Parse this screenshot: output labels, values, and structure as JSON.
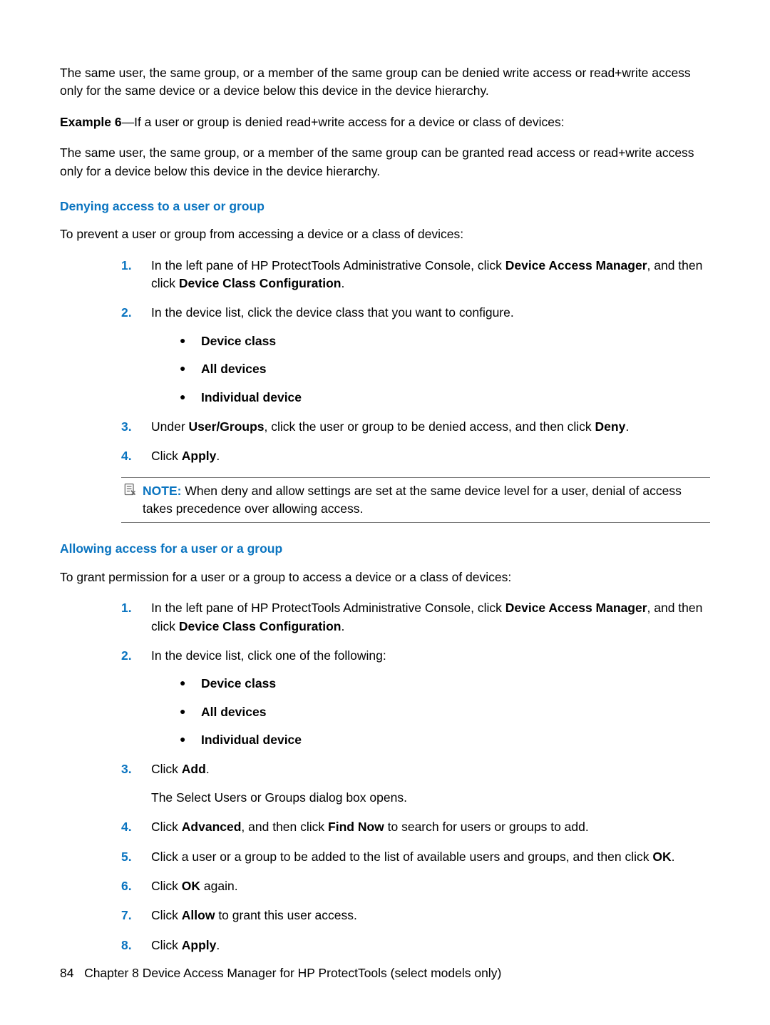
{
  "intro": {
    "p1_before": "The same user, the same group, or a member of the same group can be denied write access or read+write access only for the same device or a device below this device in the device hierarchy.",
    "example_label": "Example 6",
    "example_text": "—If a user or group is denied read+write access for a device or class of devices:",
    "p2": "The same user, the same group, or a member of the same group can be granted read access or read+write access only for a device below this device in the device hierarchy."
  },
  "deny": {
    "title": "Denying access to a user or group",
    "lead": "To prevent a user or group from accessing a device or a class of devices:",
    "steps": {
      "s1a": "In the left pane of HP ProtectTools Administrative Console, click ",
      "s1b": "Device Access Manager",
      "s1c": ", and then click ",
      "s1d": "Device Class Configuration",
      "s1e": ".",
      "s2": "In the device list, click the device class that you want to configure.",
      "bullets": {
        "b1": "Device class",
        "b2": "All devices",
        "b3": "Individual device"
      },
      "s3a": "Under ",
      "s3b": "User/Groups",
      "s3c": ", click the user or group to be denied access, and then click ",
      "s3d": "Deny",
      "s3e": ".",
      "s4a": "Click ",
      "s4b": "Apply",
      "s4c": "."
    },
    "note_label": "NOTE:",
    "note_text": "When deny and allow settings are set at the same device level for a user, denial of access takes precedence over allowing access."
  },
  "allow": {
    "title": "Allowing access for a user or a group",
    "lead": "To grant permission for a user or a group to access a device or a class of devices:",
    "steps": {
      "s1a": "In the left pane of HP ProtectTools Administrative Console, click ",
      "s1b": "Device Access Manager",
      "s1c": ", and then click ",
      "s1d": "Device Class Configuration",
      "s1e": ".",
      "s2": "In the device list, click one of the following:",
      "bullets": {
        "b1": "Device class",
        "b2": "All devices",
        "b3": "Individual device"
      },
      "s3a": "Click ",
      "s3b": "Add",
      "s3c": ".",
      "s3_after": "The Select Users or Groups dialog box opens.",
      "s4a": "Click ",
      "s4b": "Advanced",
      "s4c": ", and then click ",
      "s4d": "Find Now",
      "s4e": " to search for users or groups to add.",
      "s5a": "Click a user or a group to be added to the list of available users and groups, and then click ",
      "s5b": "OK",
      "s5c": ".",
      "s6a": "Click ",
      "s6b": "OK",
      "s6c": " again.",
      "s7a": "Click ",
      "s7b": "Allow",
      "s7c": " to grant this user access.",
      "s8a": "Click ",
      "s8b": "Apply",
      "s8c": "."
    }
  },
  "footer": {
    "page_num": "84",
    "chapter": "Chapter 8   Device Access Manager for HP ProtectTools (select models only)"
  }
}
